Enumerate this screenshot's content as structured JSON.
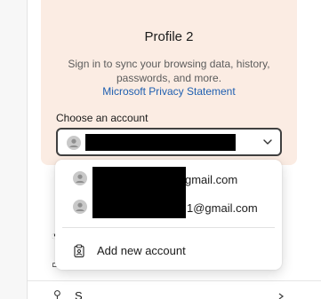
{
  "profile": {
    "name": "Profile 2",
    "sync_text": "Sign in to sync your browsing data, history, passwords, and more.",
    "privacy_link": "Microsoft Privacy Statement"
  },
  "account_picker": {
    "label": "Choose an account",
    "selected_value": ""
  },
  "dropdown": {
    "accounts": [
      {
        "email_visible": "gmail.com"
      },
      {
        "email_visible": "1@gmail.com"
      }
    ],
    "add_account_label": "Add new account"
  },
  "background": {
    "partial_row_label": "S"
  }
}
